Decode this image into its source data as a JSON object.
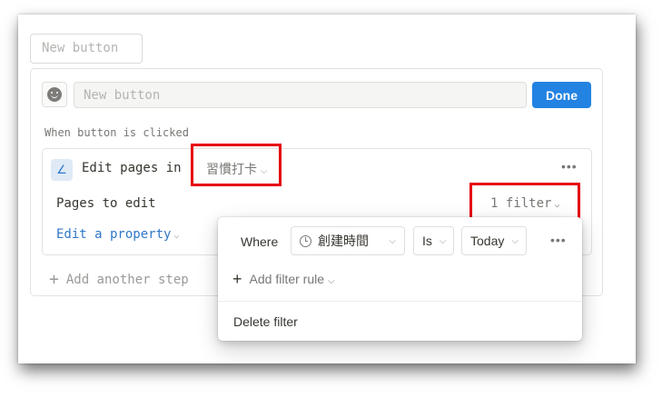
{
  "top_button": {
    "label": "New button"
  },
  "editor": {
    "name_placeholder": "New button",
    "done_label": "Done",
    "when_label": "When button is clicked"
  },
  "step": {
    "title": "Edit pages in",
    "database": "習慣打卡",
    "more": "•••",
    "pages_label": "Pages to edit",
    "filter_label": "1 filter",
    "edit_property": "Edit a property"
  },
  "add_step": {
    "label": "Add another step"
  },
  "filter_popup": {
    "where_label": "Where",
    "property": "創建時間",
    "operator": "Is",
    "value": "Today",
    "more": "•••",
    "add_rule": "Add filter rule",
    "delete": "Delete filter"
  },
  "icons": {
    "emoji": "smiley-icon",
    "step": "edit-pencil-icon",
    "property": "clock-icon",
    "chevron": "chevron-down-icon",
    "plus": "plus-icon"
  },
  "colors": {
    "accent": "#2383e2",
    "highlight": "#e60012",
    "link": "#2f77c9"
  }
}
